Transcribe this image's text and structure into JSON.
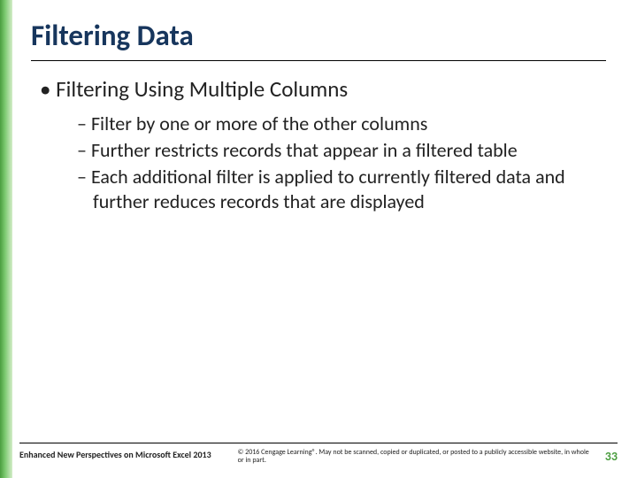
{
  "slide": {
    "title": "Filtering Data",
    "mainBullet": "Filtering Using Multiple Columns",
    "subBullets": [
      "Filter by one or more of the other columns",
      "Further restricts records that appear in a filtered table",
      "Each additional filter is applied to currently filtered data and further reduces records that are displayed"
    ]
  },
  "footer": {
    "left": "Enhanced New Perspectives on Microsoft Excel 2013",
    "center": "© 2016 Cengage Learning®. May not be scanned, copied or duplicated, or posted to a publicly accessible website, in whole or in part.",
    "pageNumber": "33"
  }
}
